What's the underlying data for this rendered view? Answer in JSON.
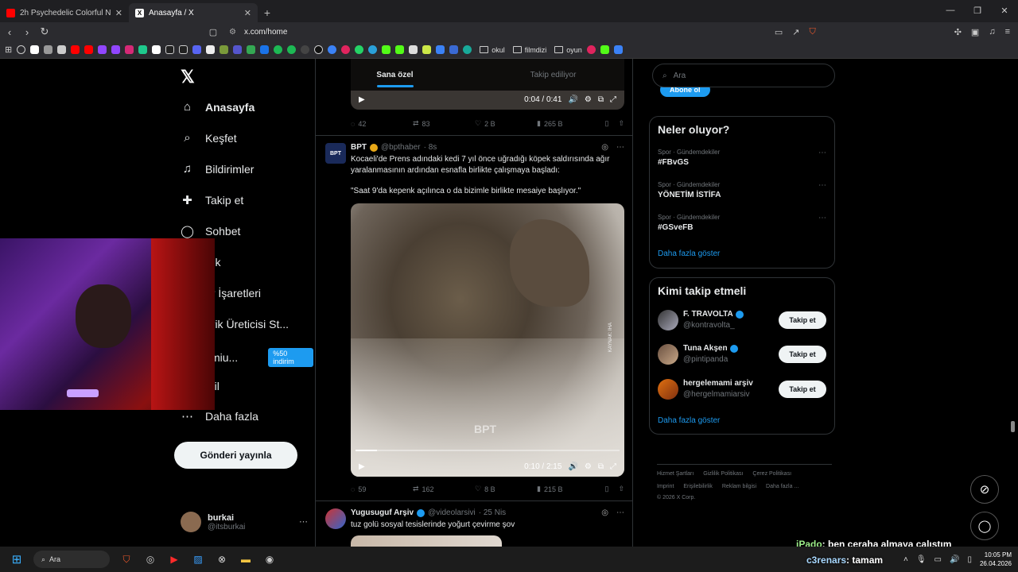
{
  "browser": {
    "tabs": [
      {
        "title": "2h Psychedelic Colorful Neon Backgr",
        "icon": "youtube-icon",
        "color": "#ff0000",
        "active": false
      },
      {
        "title": "Anasayfa / X",
        "icon": "x-icon",
        "color": "#ffffff",
        "active": true
      }
    ],
    "new_tab": "+",
    "url": "x.com/home",
    "bookmark_folders": [
      "okul",
      "filmdizi",
      "oyun"
    ]
  },
  "sidebar": {
    "logo": "𝕏",
    "items": [
      {
        "label": "Anasayfa",
        "icon": "home-icon",
        "glyph": "⌂"
      },
      {
        "label": "Keşfet",
        "icon": "search-icon",
        "glyph": "⌕"
      },
      {
        "label": "Bildirimler",
        "icon": "bell-icon",
        "glyph": "🔔"
      },
      {
        "label": "Takip et",
        "icon": "follow-icon",
        "glyph": "👤"
      },
      {
        "label": "Sohbet",
        "icon": "chat-icon",
        "glyph": "◯"
      },
      {
        "label": "rok",
        "icon": "grok-icon",
        "glyph": "◫"
      },
      {
        "label": "er İşaretleri",
        "icon": "bookmark-icon",
        "glyph": "🔖"
      },
      {
        "label": "erik Üreticisi St...",
        "icon": "creator-icon",
        "glyph": "⚡"
      },
      {
        "label": "emiu...",
        "icon": "premium-icon",
        "glyph": "𝕏"
      },
      {
        "label": "ofil",
        "icon": "profile-icon",
        "glyph": "👤"
      },
      {
        "label": "Daha fazla",
        "icon": "more-icon",
        "glyph": "⋯"
      }
    ],
    "premium_badge": "%50 indirim",
    "post_button": "Gönderi yayınla",
    "user": {
      "name": "burkai",
      "handle": "@itsburkai"
    }
  },
  "feed": {
    "tabs": [
      "Sana özel",
      "Takip ediliyor"
    ],
    "top_video": {
      "time": "0:04 / 0:41",
      "progress": 0.1
    },
    "top_actions": {
      "replies": "42",
      "reposts": "83",
      "likes": "2 B",
      "views": "265 B"
    },
    "tweet1": {
      "name": "BPT",
      "handle": "@bpthaber",
      "time": "· 8s",
      "text1": "Kocaeli'de Prens adındaki kedi 7 yıl önce uğradığı köpek saldırısında ağır yaralanmasının ardından esnafla birlikte çalışmaya başladı:",
      "text2": "\"Saat 9'da kepenk açılınca o da bizimle birlikte mesaiye başlıyor.\"",
      "watermark": "BPT",
      "side_label": "KAYNAK: İHA",
      "video_time": "0:10 / 2:15",
      "progress": 0.08,
      "actions": {
        "replies": "59",
        "reposts": "162",
        "likes": "8 B",
        "views": "215 B"
      }
    },
    "tweet2": {
      "name": "Yugusuguf Arşiv",
      "handle": "@videolarsivi",
      "time": "· 25 Nis",
      "text": "tuz golü sosyal tesislerinde yoğurt çevirme şov"
    }
  },
  "right": {
    "search_placeholder": "Ara",
    "subscribe": "Abone ol",
    "trends_title": "Neler oluyor?",
    "trends": [
      {
        "category": "Spor · Gündemdekiler",
        "topic": "#FBvGS"
      },
      {
        "category": "Spor · Gündemdekiler",
        "topic": "YÖNETİM İSTİFA"
      },
      {
        "category": "Spor · Gündemdekiler",
        "topic": "#GSveFB"
      }
    ],
    "show_more": "Daha fazla göster",
    "who_title": "Kimi takip etmeli",
    "who": [
      {
        "name": "F. TRAVOLTA",
        "handle": "@kontravolta_",
        "verified": true,
        "button": "Takip et"
      },
      {
        "name": "Tuna Akşen",
        "handle": "@pintipanda",
        "verified": true,
        "button": "Takip et"
      },
      {
        "name": "hergelemami arşiv",
        "handle": "@hergelmamiarsiv",
        "verified": false,
        "button": "Takip et"
      }
    ],
    "footer": {
      "l1": [
        "Hizmet Şartları",
        "Gizlilik Politikası",
        "Çerez Politikası"
      ],
      "l2": [
        "Imprint",
        "Erişilebilirlik",
        "Reklam bilgisi",
        "Daha fazla ..."
      ],
      "copyright": "© 2026 X Corp."
    }
  },
  "chat": [
    {
      "user": "iPado",
      "msg": ": ben ceraha almaya çalıştım"
    },
    {
      "user": "c3renars",
      "msg": ": tamam"
    }
  ],
  "taskbar": {
    "search": "Ara",
    "time": "10:05 PM",
    "date": "26.04.2026"
  },
  "colors": {
    "accent": "#1d9bf0",
    "verified_gold": "#e8a818"
  }
}
